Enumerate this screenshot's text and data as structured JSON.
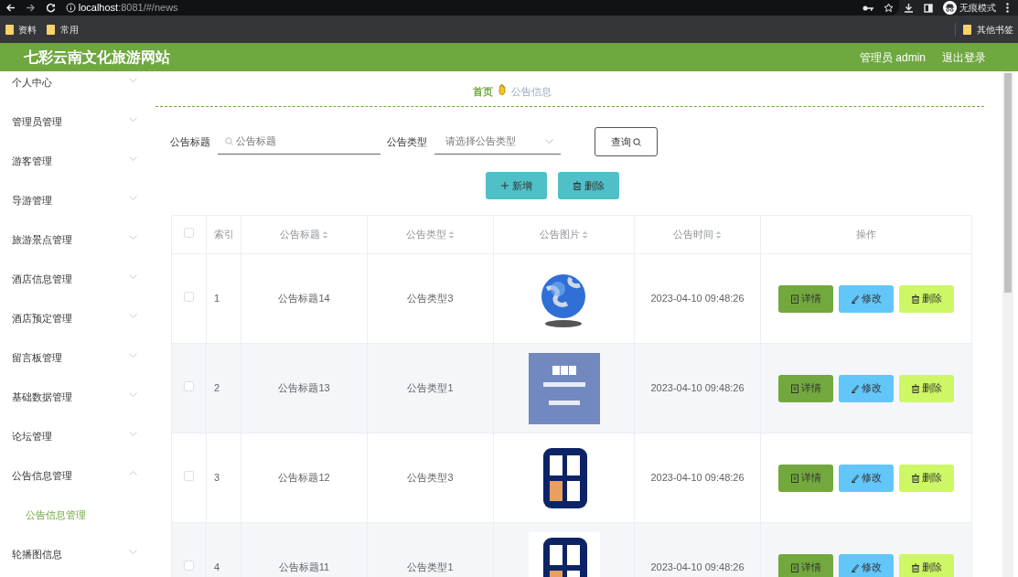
{
  "browser": {
    "url_host": "localhost",
    "url_path": ":8081/#/news",
    "bookmarks": [
      "资料",
      "常用"
    ],
    "other_bookmarks": "其他书签",
    "profile": "无痕模式"
  },
  "header": {
    "title": "七彩云南文化旅游网站",
    "user": "管理员 admin",
    "logout": "退出登录"
  },
  "sidebar": {
    "items": [
      {
        "label": "个人中心",
        "expanded": false
      },
      {
        "label": "管理员管理",
        "expanded": false
      },
      {
        "label": "游客管理",
        "expanded": false
      },
      {
        "label": "导游管理",
        "expanded": false
      },
      {
        "label": "旅游景点管理",
        "expanded": false
      },
      {
        "label": "酒店信息管理",
        "expanded": false
      },
      {
        "label": "酒店预定管理",
        "expanded": false
      },
      {
        "label": "留言板管理",
        "expanded": false
      },
      {
        "label": "基础数据管理",
        "expanded": false
      },
      {
        "label": "论坛管理",
        "expanded": false
      },
      {
        "label": "公告信息管理",
        "expanded": true,
        "children": [
          {
            "label": "公告信息管理",
            "selected": true
          }
        ]
      },
      {
        "label": "轮播图信息",
        "expanded": false
      }
    ]
  },
  "breadcrumb": [
    "首页",
    "公告信息"
  ],
  "search": {
    "fields": [
      {
        "label": "公告标题",
        "placeholder": "公告标题",
        "kind": "text"
      },
      {
        "label": "公告类型",
        "placeholder": "请选择公告类型",
        "kind": "select"
      }
    ],
    "button": "查询"
  },
  "actions": [
    {
      "label": "新增",
      "kind": "add"
    },
    {
      "label": "删除",
      "kind": "delete"
    }
  ],
  "table": {
    "select_all": false,
    "columns": [
      {
        "label": "索引",
        "sortable": false
      },
      {
        "label": "公告标题",
        "sortable": true
      },
      {
        "label": "公告类型",
        "sortable": true
      },
      {
        "label": "公告图片",
        "sortable": true
      },
      {
        "label": "公告时间",
        "sortable": true
      },
      {
        "label": "操作",
        "sortable": false
      }
    ],
    "rows": [
      {
        "checked": false,
        "index": "1",
        "title": "公告标题14",
        "type": "公告类型3",
        "time": "2023-04-10 09:48:26",
        "buttons": [
          {
            "label": "详情",
            "kind": "detail"
          },
          {
            "label": "修改",
            "kind": "edit"
          },
          {
            "label": "删除",
            "kind": "delete"
          }
        ]
      },
      {
        "checked": false,
        "index": "2",
        "title": "公告标题13",
        "type": "公告类型1",
        "time": "2023-04-10 09:48:26",
        "buttons": [
          {
            "label": "详情",
            "kind": "detail"
          },
          {
            "label": "修改",
            "kind": "edit"
          },
          {
            "label": "删除",
            "kind": "delete"
          }
        ]
      },
      {
        "checked": false,
        "index": "3",
        "title": "公告标题12",
        "type": "公告类型3",
        "time": "2023-04-10 09:48:26",
        "buttons": [
          {
            "label": "详情",
            "kind": "detail"
          },
          {
            "label": "修改",
            "kind": "edit"
          },
          {
            "label": "删除",
            "kind": "delete"
          }
        ]
      },
      {
        "checked": false,
        "index": "4",
        "title": "公告标题11",
        "type": "公告类型1",
        "time": "2023-04-10 09:48:26",
        "buttons": [
          {
            "label": "详情",
            "kind": "detail"
          },
          {
            "label": "修改",
            "kind": "edit"
          },
          {
            "label": "删除",
            "kind": "delete"
          }
        ]
      }
    ]
  }
}
